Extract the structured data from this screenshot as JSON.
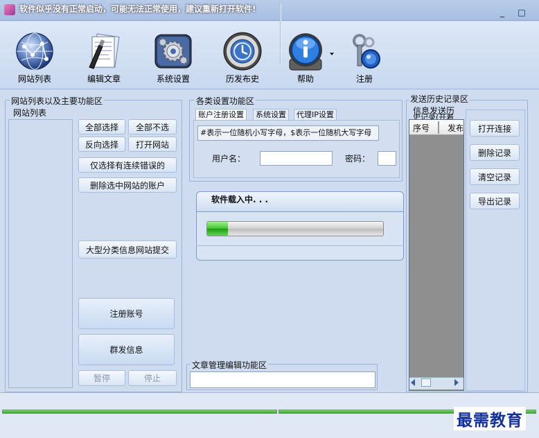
{
  "window": {
    "title": "软件似乎没有正常启动，可能无法正常使用，建议重新打开软件!",
    "minimize": "_",
    "maximize": "□"
  },
  "toolbar": {
    "items": [
      {
        "label": "网站列表",
        "icon": "globe-network-icon"
      },
      {
        "label": "编辑文章",
        "icon": "document-pen-icon"
      },
      {
        "label": "系统设置",
        "icon": "gear-settings-icon"
      },
      {
        "label": "历发布史",
        "icon": "clock-history-icon"
      },
      {
        "label": "帮助",
        "icon": "info-help-icon"
      },
      {
        "label": "注册",
        "icon": "keys-register-icon"
      }
    ]
  },
  "left_panel": {
    "title": "网站列表以及主要功能区",
    "list_title": "网站列表",
    "buttons": {
      "select_all": "全部选择",
      "select_none": "全部不选",
      "invert": "反向选择",
      "open_site": "打开网站",
      "select_errors": "仅选择有连续错误的",
      "delete_accounts": "删除选中网站的账户",
      "classified_submit": "大型分类信息网站提交",
      "register": "注册账号",
      "mass_send": "群发信息",
      "pause": "暂停",
      "stop": "停止"
    }
  },
  "settings_panel": {
    "title": "各类设置功能区",
    "tabs": [
      "账户注册设置",
      "系统设置",
      "代理IP设置"
    ],
    "hint_text": "#表示一位随机小写字母，$表示一位随机大写字母",
    "username_label": "用户名：",
    "username_value": "",
    "password_label": "密码：",
    "password_value": ""
  },
  "loading": {
    "text": "软件载入中. . .",
    "progress": 0.12
  },
  "article_panel": {
    "title": "文章管理编辑功能区"
  },
  "history_panel": {
    "title": "发送历史记录区",
    "subtitle": "信息发送历",
    "subtitle2": "史记录(开着",
    "columns": [
      "序号",
      "发布"
    ],
    "buttons": {
      "open_link": "打开连接",
      "delete_record": "删除记录",
      "clear_records": "清空记录",
      "export_records": "导出记录"
    }
  },
  "watermark": "最需教育"
}
